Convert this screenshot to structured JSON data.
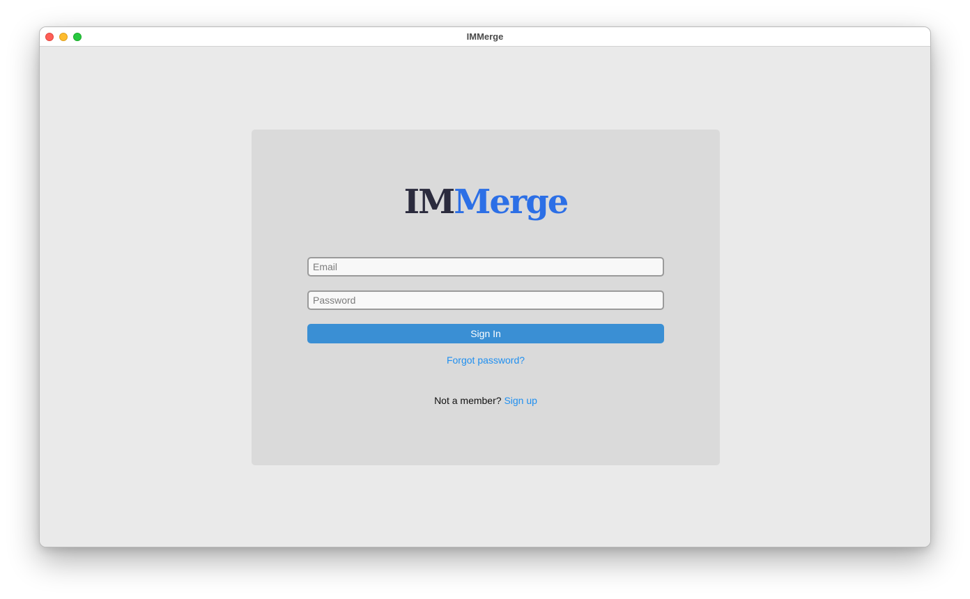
{
  "window": {
    "title": "IMMerge"
  },
  "logo": {
    "part_dark": "IM",
    "part_blue": "Merge"
  },
  "form": {
    "email_placeholder": "Email",
    "email_value": "",
    "password_placeholder": "Password",
    "password_value": "",
    "signin_label": "Sign In",
    "forgot_label": "Forgot password?",
    "signup_prompt": "Not a member?",
    "signup_label": "Sign up"
  },
  "colors": {
    "accent": "#3a8fd4",
    "link": "#1f8ff0",
    "logo_dark": "#2b2b3d",
    "logo_blue": "#2c6fe6"
  },
  "icons": {
    "close": "close-icon",
    "minimize": "minimize-icon",
    "maximize": "maximize-icon"
  }
}
